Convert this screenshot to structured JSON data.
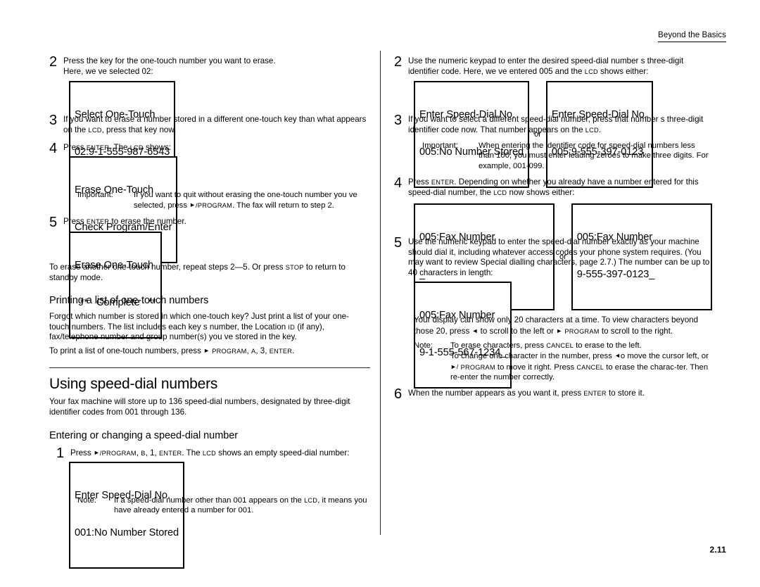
{
  "header": {
    "running_head": "Beyond the Basics"
  },
  "footer": {
    "page_number": "2.11"
  },
  "left_column": {
    "step2": {
      "number": "2",
      "line1": "Press the key for the one-touch number you want to erase.",
      "line2": "Here, we ve selected 02:",
      "lcd": {
        "line1": "Select One-Touch",
        "line2": "02:9-1-555-987-6543"
      }
    },
    "step3": {
      "number": "3",
      "text_a": "If you want to erase a number stored in a different one-touch key than what appears on the ",
      "key_lcd": "LCD",
      "text_b": ", press that key now."
    },
    "step4": {
      "number": "4",
      "text_a": "Press ",
      "key_enter": "ENTER",
      "text_b": ". The ",
      "key_lcd": "LCD",
      "text_c": " shows:",
      "lcd": {
        "line1": "Erase One-Touch",
        "line2": "Check Program/Enter"
      },
      "important": {
        "label": "Important:",
        "text_a": "If you want to quit without erasing the one-touch number you ve selected, press ",
        "arrow": "►",
        "key_program": "/PROGRAM",
        "text_b": ". The fax will return to step 2."
      }
    },
    "step5": {
      "number": "5",
      "text_a": "Press ",
      "key_enter": "ENTER",
      "text_b": " to erase the number.",
      "lcd": {
        "line1": "Erase One-Touch",
        "line2": "  **   Complete   **"
      }
    },
    "closing_para": {
      "text_a": "To erase another one-touch number, repeat steps 2—5. Or press ",
      "key_stop": "STOP",
      "text_b": " to return to standby mode."
    },
    "printing_section": {
      "heading": "Printing a list of one-touch numbers",
      "para_a": "Forgot which number is stored in which one-touch key? Just print a list of your one-touch numbers. The list includes each key s number, the Location ",
      "key_id": "ID",
      "para_b": " (if any), fax/telephone number and group number(s) you ve stored in the key.",
      "print_line_a": "To print a list of one-touch numbers, press ",
      "arrow": "►",
      "key_program": "PROGRAM",
      "print_line_b": ", ",
      "key_a": "A",
      "print_line_c": ", 3, ",
      "key_enter": "ENTER",
      "print_line_d": "."
    },
    "speeddial_section": {
      "heading": "Using speed-dial numbers",
      "intro": "Your fax machine will store up to 136 speed-dial numbers, designated by three-digit identifier codes from  001 through  136.",
      "subheading": "Entering or changing a speed-dial number",
      "step1": {
        "number": "1",
        "text_a": "Press ",
        "arrow": "►",
        "key_program": "/PROGRAM",
        "text_b": ", ",
        "key_b": "B",
        "text_c": ", 1, ",
        "key_enter": "ENTER",
        "text_d": ". The ",
        "key_lcd": "LCD",
        "text_e": " shows an empty speed-dial number:",
        "lcd": {
          "line1": "Enter Speed-Dial No.",
          "line2": "001:No Number Stored"
        },
        "note": {
          "label": "Note:",
          "text_a": "If a speed-dial number other than  001 appears on the ",
          "key_lcd": "LCD",
          "text_b": ", it means you have already entered a number for  001."
        }
      }
    }
  },
  "right_column": {
    "step2": {
      "number": "2",
      "text_a": "Use the numeric keypad to enter the desired speed-dial number s three-digit identifier code. Here, we ve entered  005 and the ",
      "key_lcd": "LCD",
      "text_b": " shows either:",
      "lcd_left": {
        "line1": "Enter Speed-Dial No.",
        "line2": "005:No Number Stored"
      },
      "or_label": "or",
      "lcd_right": {
        "line1": "Enter Speed-Dial No.",
        "line2": "005:9-555-397-0123"
      }
    },
    "step3": {
      "number": "3",
      "text_a": "If you want to select a different speed-dial number, press that number s three-digit identifier code now. That number appears on the ",
      "key_lcd": "LCD",
      "text_b": ".",
      "important": {
        "label": "Important:",
        "text": "When entering the identifier code for speed-dial numbers less than 100, you must  enter leading zeroes to make three digits. For example, 001-099."
      }
    },
    "step4": {
      "number": "4",
      "text_a": "Press ",
      "key_enter": "ENTER",
      "text_b": ". Depending on whether you already have a number entered for this speed-dial number, the  ",
      "key_lcd": "LCD",
      "text_c": " now shows either:",
      "lcd_left": {
        "line1": "005:Fax Number",
        "line2": "_"
      },
      "or_label": "or",
      "lcd_right": {
        "line1": "005:Fax Number",
        "line2": "9-555-397-0123_"
      }
    },
    "step5": {
      "number": "5",
      "text": "Use the numeric keypad to enter the speed-dial number  exactly as your machine should dial it, including whatever access codes your phone system requires. (You may want to review  Special dialling characters,  page 2.7.) The number can be up to 40 characters in length:",
      "lcd": {
        "line1": "005:Fax Number",
        "line2": "9-1-555-567-1234_"
      },
      "after_para_a": "Your display can show only 20 characters at a time. To view characters beyond those 20, press ",
      "arrow_left": "◄",
      "after_para_b": " to scroll to the left or  ",
      "arrow_right": "►",
      "key_program": "PROGRAM",
      "after_para_c": " to scroll to the right.",
      "note": {
        "label": "Note:",
        "line1_a": "To erase characters, press ",
        "key_cancel_1": "CANCEL",
        "line1_b": " to erase to the left.",
        "line2_a": "To change one character in the number, press  ",
        "arrow_left": "◄",
        "line2_b": "o move the cursor left, or ",
        "arrow_right": "►/",
        "key_program": "PROGRAM",
        "line2_c": " to move it right. Press ",
        "key_cancel_2": "CANCEL",
        "line2_d": " to erase the charac-ter. Then re-enter the number correctly."
      }
    },
    "step6": {
      "number": "6",
      "text_a": "When the number appears as you want it, press  ",
      "key_enter": "ENTER",
      "text_b": " to store it."
    }
  }
}
